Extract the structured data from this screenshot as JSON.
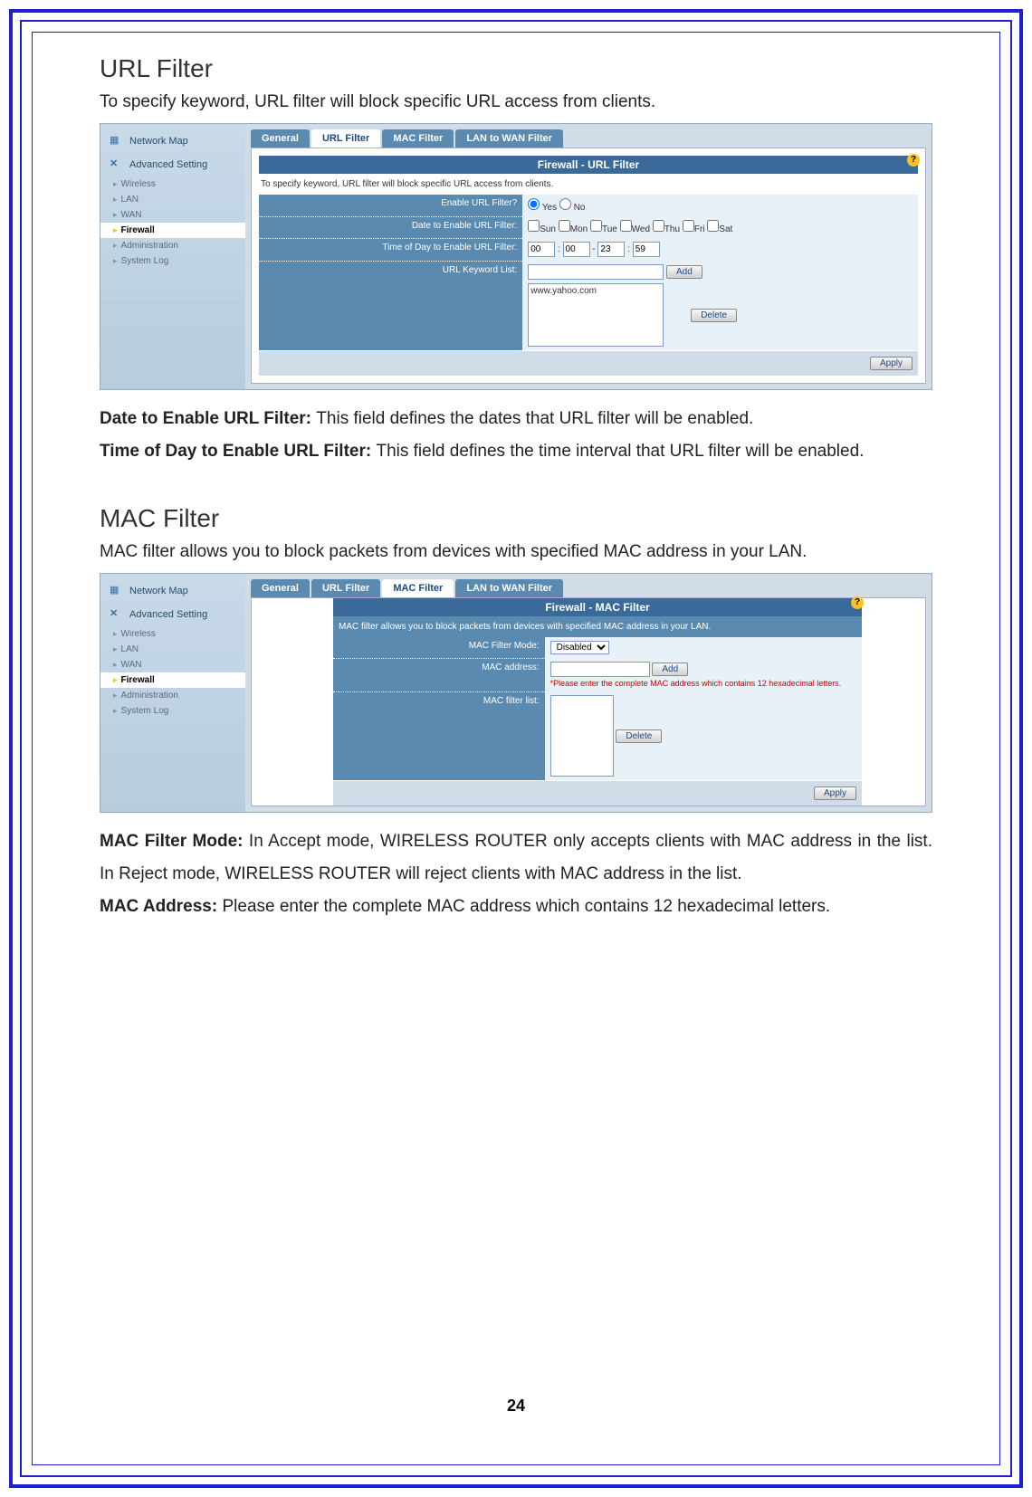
{
  "sections": {
    "url": {
      "heading": "URL Filter",
      "desc": "To specify keyword, URL filter will block specific URL access from clients."
    },
    "mac": {
      "heading": "MAC Filter",
      "desc": "MAC filter allows you to block packets from devices with specified MAC address in your LAN."
    }
  },
  "sidebar": {
    "network_map": "Network Map",
    "advanced": "Advanced Setting",
    "items": [
      "Wireless",
      "LAN",
      "WAN",
      "Firewall",
      "Administration",
      "System Log"
    ]
  },
  "tabs": [
    "General",
    "URL Filter",
    "MAC Filter",
    "LAN to WAN Filter"
  ],
  "url_panel": {
    "title": "Firewall - URL Filter",
    "desc": "To specify keyword, URL filter will block specific URL access from clients.",
    "rows": {
      "enable": "Enable URL Filter?",
      "date": "Date to Enable URL Filter:",
      "time": "Time of Day to Enable URL Filter:",
      "list": "URL Keyword List:"
    },
    "yes": "Yes",
    "no": "No",
    "days": [
      "Sun",
      "Mon",
      "Tue",
      "Wed",
      "Thu",
      "Fri",
      "Sat"
    ],
    "time_vals": [
      "00",
      "00",
      "23",
      "59"
    ],
    "keyword": "www.yahoo.com",
    "add": "Add",
    "delete": "Delete",
    "apply": "Apply"
  },
  "mac_panel": {
    "title": "Firewall - MAC Filter",
    "desc": "MAC filter allows you to block packets from devices with specified MAC address in your LAN.",
    "rows": {
      "mode": "MAC Filter Mode:",
      "addr": "MAC address:",
      "list": "MAC filter list:"
    },
    "mode_val": "Disabled",
    "note": "*Please enter the complete MAC address which contains 12 hexadecimal letters.",
    "add": "Add",
    "delete": "Delete",
    "apply": "Apply"
  },
  "defs": {
    "date_label": "Date to Enable URL Filter: ",
    "date_text": "This field defines the dates that URL filter will be enabled.",
    "time_label": "Time of Day to Enable URL Filter: ",
    "time_text": "This field defines the time interval that URL filter will be enabled.",
    "mode_label": "MAC Filter Mode: ",
    "mode_text": "In Accept mode, WIRELESS ROUTER only accepts clients with MAC address in the list. In Reject mode, WIRELESS ROUTER will reject clients with MAC address in the list.",
    "addr_label": "MAC Address: ",
    "addr_text": "Please enter the complete MAC address which contains 12 hexadecimal letters."
  },
  "page_number": "24"
}
